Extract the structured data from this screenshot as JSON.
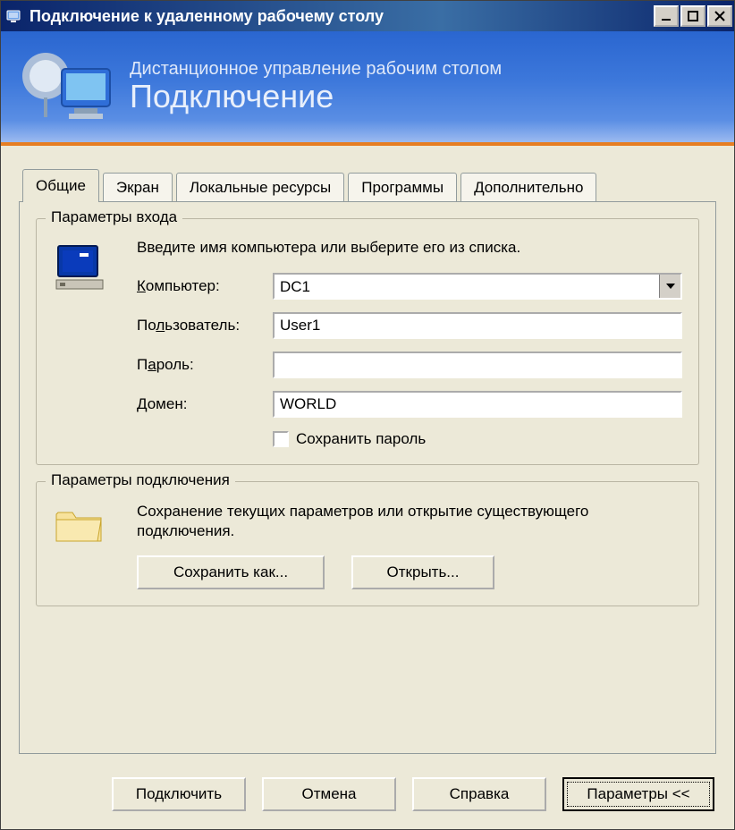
{
  "titlebar": {
    "text": "Подключение к удаленному рабочему столу"
  },
  "banner": {
    "sub": "Дистанционное управление рабочим столом",
    "main": "Подключение"
  },
  "tabs": {
    "items": [
      {
        "label": "Общие"
      },
      {
        "label": "Экран"
      },
      {
        "label": "Локальные ресурсы"
      },
      {
        "label": "Программы"
      },
      {
        "label": "Дополнительно"
      }
    ]
  },
  "login": {
    "legend": "Параметры входа",
    "instruction": "Введите имя компьютера или выберите его из списка.",
    "fields": {
      "computer": {
        "label_pre": "",
        "label_u": "К",
        "label_post": "омпьютер:",
        "value": "DC1"
      },
      "user": {
        "label_pre": "По",
        "label_u": "л",
        "label_post": "ьзователь:",
        "value": "User1"
      },
      "password": {
        "label_pre": "П",
        "label_u": "а",
        "label_post": "роль:",
        "value": ""
      },
      "domain": {
        "label_pre": "",
        "label_u": "Д",
        "label_post": "омен:",
        "value": "WORLD"
      }
    },
    "save_pw": {
      "label_pre": "Сох",
      "label_u": "р",
      "label_post": "анить пароль"
    }
  },
  "conn": {
    "legend": "Параметры подключения",
    "desc": "Сохранение текущих параметров или открытие существующего подключения.",
    "save_as": {
      "pre": "Сохранить к",
      "u": "а",
      "post": "к..."
    },
    "open": {
      "pre": "О",
      "u": "т",
      "post": "крыть..."
    }
  },
  "bottom": {
    "connect": {
      "pre": "Подкл",
      "u": "ю",
      "post": "чить"
    },
    "cancel": "Отмена",
    "help": {
      "pre": "",
      "u": "С",
      "post": "правка"
    },
    "params": {
      "pre": "",
      "u": "П",
      "post": "араметры <<"
    }
  }
}
